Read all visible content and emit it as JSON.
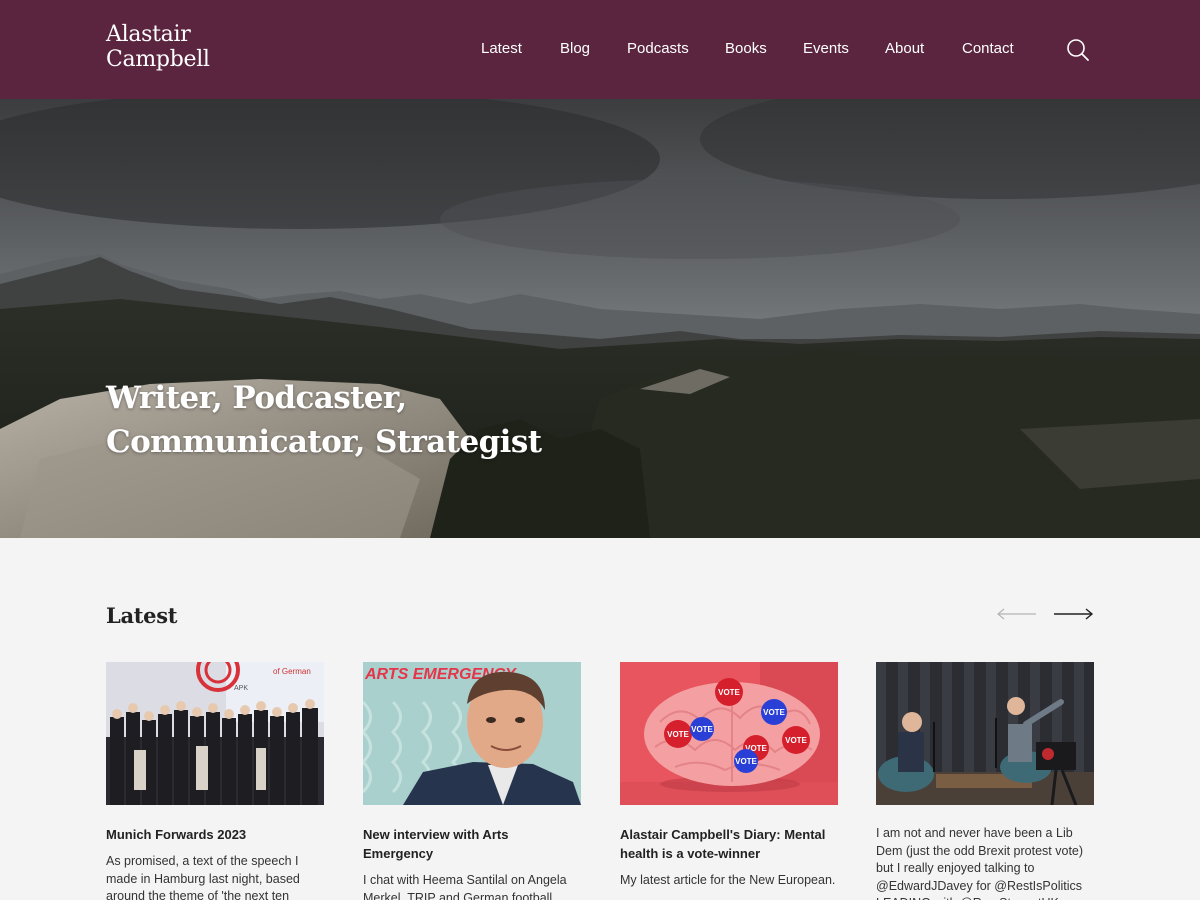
{
  "header": {
    "logo_line1": "Alastair",
    "logo_line2": "Campbell",
    "nav": [
      "Latest",
      "Blog",
      "Podcasts",
      "Books",
      "Events",
      "About",
      "Contact"
    ]
  },
  "hero": {
    "title_line1": "Writer, Podcaster,",
    "title_line2": "Communicator, Strategist"
  },
  "latest": {
    "heading": "Latest",
    "cards": [
      {
        "title": "Munich Forwards 2023",
        "text": "As promised, a text of the speech I made in Hamburg last night, based around the theme of 'the next ten"
      },
      {
        "title": "New interview with Arts Emergency",
        "text": "I chat with Heema Santilal on Angela Merkel, TRIP and German football"
      },
      {
        "title": "Alastair Campbell's Diary: Mental health is a vote-winner",
        "text": "My latest article for the New European."
      },
      {
        "title": "",
        "text": "I am not and never have been a Lib Dem (just the odd Brexit protest vote) but I really enjoyed talking to @EdwardJDavey for @RestIsPolitics LEADING with @RoryStewartUK"
      }
    ]
  },
  "image_text": {
    "arts_emergency": "ARTS EMERGENCY",
    "vote": "VOTE",
    "apk": "APK",
    "of_german": "of German"
  }
}
